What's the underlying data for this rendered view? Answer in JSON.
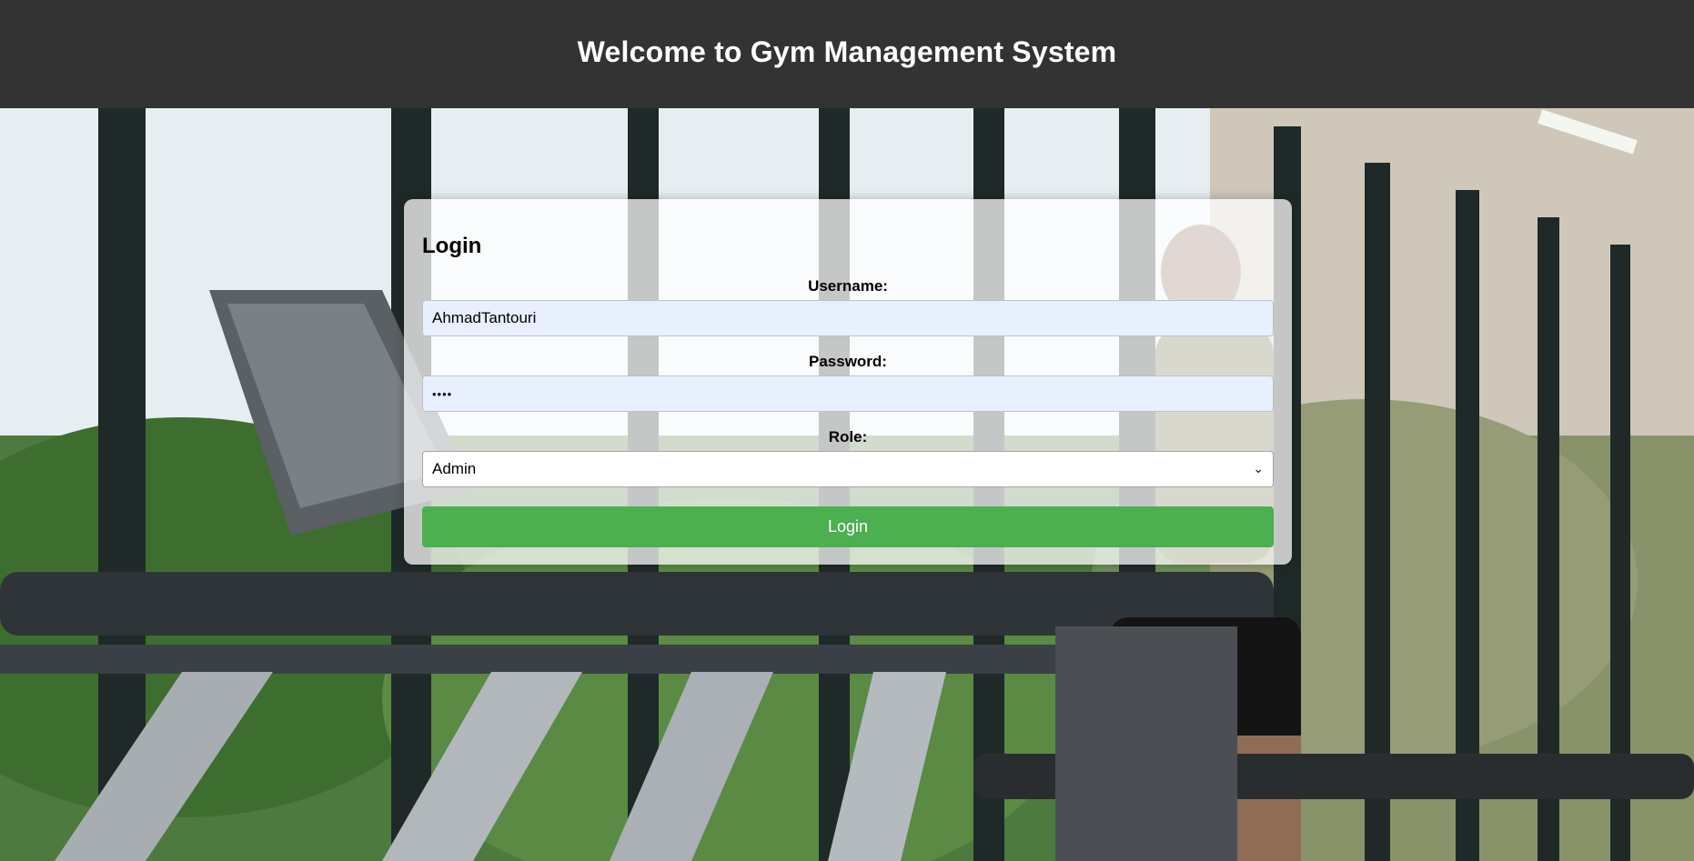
{
  "header": {
    "title": "Welcome to Gym Management System"
  },
  "login": {
    "heading": "Login",
    "username": {
      "label": "Username:",
      "value": "AhmadTantouri"
    },
    "password": {
      "label": "Password:",
      "value": "••••"
    },
    "role": {
      "label": "Role:",
      "selected": "Admin"
    },
    "submit_label": "Login"
  },
  "colors": {
    "header_bg": "#333333",
    "button_bg": "#4caf50",
    "autofill_bg": "#e8f0fe"
  },
  "icons": {
    "select_chevron": "chevron-down-icon"
  }
}
